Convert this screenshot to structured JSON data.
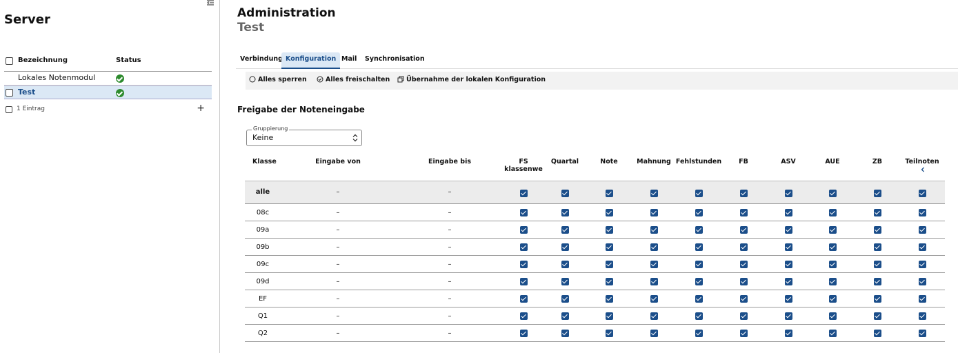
{
  "sidebar": {
    "title": "Server",
    "columns": {
      "name": "Bezeichnung",
      "status": "Status"
    },
    "rows": [
      {
        "name": "Lokales Notenmodul",
        "status": "ok"
      },
      {
        "name": "Test",
        "status": "ok"
      }
    ],
    "footer": {
      "count": "1 Eintrag",
      "add": "+"
    }
  },
  "main": {
    "title": "Administration",
    "subtitle": "Test",
    "tabs": [
      "Verbindung",
      "Konfiguration",
      "Mail",
      "Synchronisation"
    ],
    "active_tab": "Konfiguration",
    "toolbar": {
      "lock_all": "Alles sperren",
      "unlock_all": "Alles freischalten",
      "adopt_local": "Übernahme der lokalen Konfiguration"
    },
    "section_title": "Freigabe der Noteneingabe",
    "grouping": {
      "label": "Gruppierung",
      "value": "Keine"
    }
  },
  "table": {
    "headers": {
      "klasse": "Klasse",
      "von": "Eingabe von",
      "bis": "Eingabe bis",
      "flags": [
        "FS\nklassenwe",
        "Quartal",
        "Note",
        "Mahnung",
        "Fehlstunden",
        "FB",
        "ASV",
        "AUE",
        "ZB",
        "Teilnoten"
      ]
    },
    "rows": [
      {
        "klasse": "alle",
        "von": "–",
        "bis": "–"
      },
      {
        "klasse": "08c",
        "von": "–",
        "bis": "–"
      },
      {
        "klasse": "09a",
        "von": "–",
        "bis": "–"
      },
      {
        "klasse": "09b",
        "von": "–",
        "bis": "–"
      },
      {
        "klasse": "09c",
        "von": "–",
        "bis": "–"
      },
      {
        "klasse": "09d",
        "von": "–",
        "bis": "–"
      },
      {
        "klasse": "EF",
        "von": "–",
        "bis": "–"
      },
      {
        "klasse": "Q1",
        "von": "–",
        "bis": "–"
      },
      {
        "klasse": "Q2",
        "von": "–",
        "bis": "–"
      }
    ],
    "all_checked": true
  },
  "colors": {
    "accent": "#1b4e8a",
    "selected_bg": "#dbe8f5",
    "ok": "#2e8b2e"
  }
}
